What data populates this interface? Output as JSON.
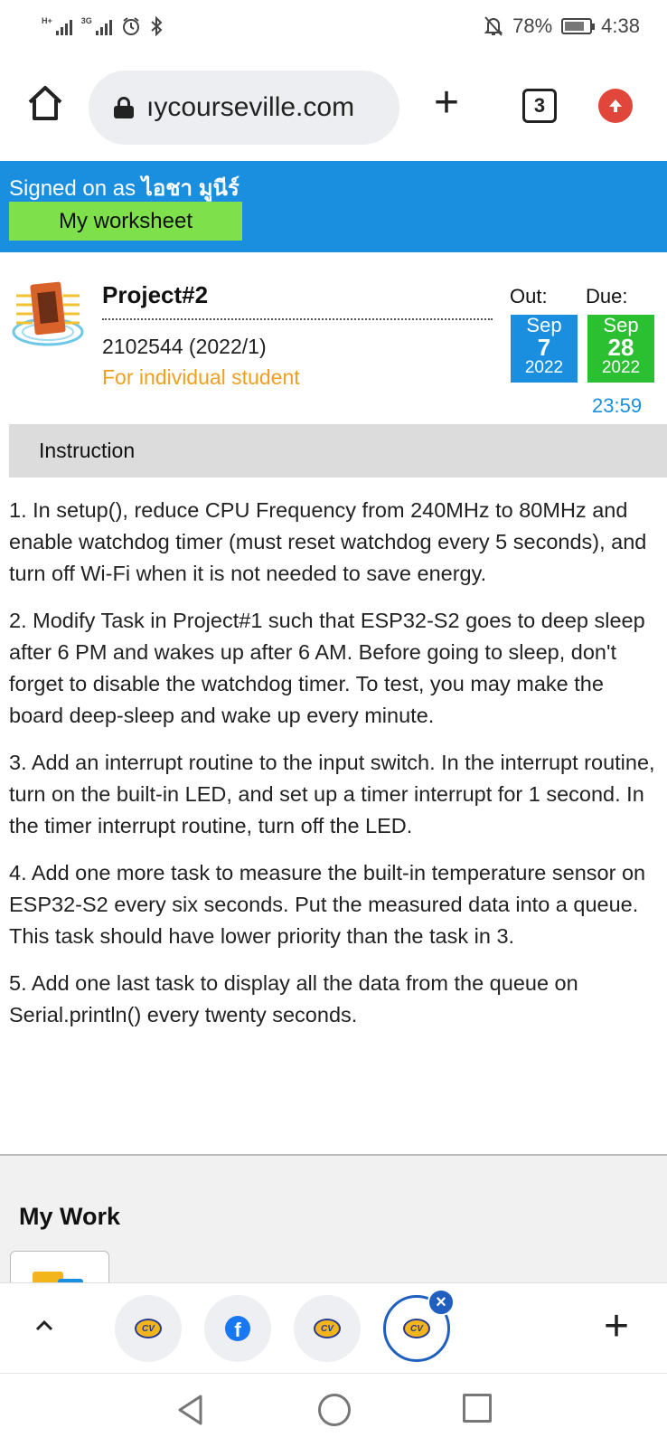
{
  "status_bar": {
    "signal_1_label": "H+",
    "signal_2_label": "3G",
    "battery_percent": "78%",
    "time": "4:38"
  },
  "browser": {
    "url": "ıycourseville.com",
    "tab_count": "3"
  },
  "signed": {
    "prefix": "Signed on as",
    "name": "ไอชา มูนีร์",
    "worksheet_button": "My worksheet"
  },
  "project": {
    "title": "Project#2",
    "course": "2102544 (2022/1)",
    "audience": "For individual student",
    "out_label": "Out:",
    "due_label": "Due:",
    "out_date": {
      "month": "Sep",
      "day": "7",
      "year": "2022"
    },
    "due_date": {
      "month": "Sep",
      "day": "28",
      "year": "2022"
    },
    "due_time": "23:59"
  },
  "instruction": {
    "heading": "Instruction",
    "items": [
      "1.  In setup(), reduce CPU Frequency from 240MHz to 80MHz and enable watchdog timer (must reset watchdog every 5 seconds), and turn off Wi-Fi when it is not needed to save energy.",
      "2. Modify Task in Project#1 such that ESP32-S2 goes to deep sleep after 6 PM and wakes up after 6 AM.  Before going to sleep, don't forget to disable the watchdog timer. To test, you may make the board deep-sleep and wake up every minute.",
      "3. Add an interrupt routine to the input switch. In the interrupt routine, turn on the built-in LED, and set up a timer interrupt for 1 second.  In the timer interrupt routine, turn off the LED.",
      "4. Add one more task to measure the built-in temperature sensor on ESP32-S2 every six seconds.  Put the measured data into a queue. This task should have lower priority than the task in 3.",
      "5.  Add one last task to display all the data from the queue on Serial.println() every twenty seconds."
    ]
  },
  "my_work": {
    "heading": "My Work"
  },
  "tab_bar": {
    "tabs": [
      {
        "icon": "courseville-icon",
        "label": "CV"
      },
      {
        "icon": "facebook-icon",
        "label": "f"
      },
      {
        "icon": "courseville-icon",
        "label": "CV"
      },
      {
        "icon": "courseville-icon",
        "label": "CV",
        "active": true
      }
    ],
    "close_glyph": "×",
    "plus_glyph": "+"
  },
  "colors": {
    "signed_bar": "#1a8fe0",
    "worksheet_button": "#7ee04a",
    "out_date": "#1a8fe0",
    "due_date": "#2bbf32",
    "audience_text": "#f0a020",
    "active_tab": "#1f5fbf"
  }
}
